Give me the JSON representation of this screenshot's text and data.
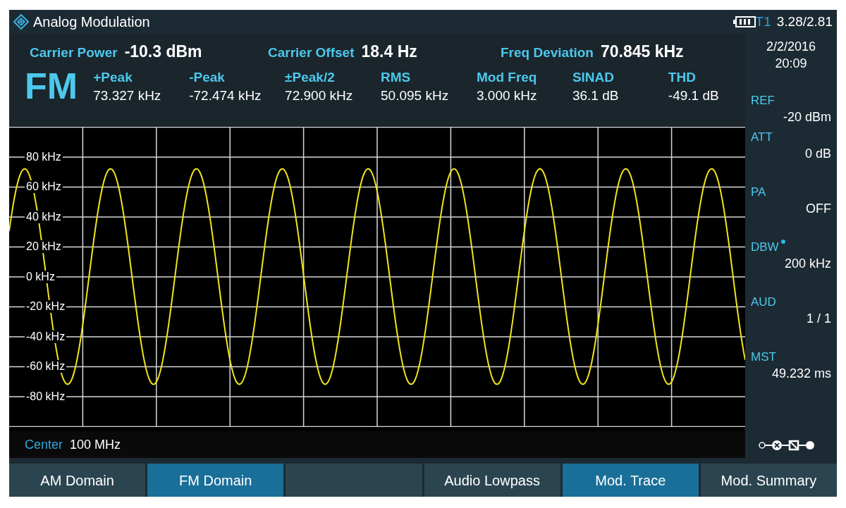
{
  "window": {
    "title": "Analog Modulation",
    "trace": "T1",
    "reading": "3.28/2.81",
    "date": "2/2/2016",
    "time": "20:09"
  },
  "summary": [
    {
      "label": "Carrier Power",
      "value": "-10.3 dBm"
    },
    {
      "label": "Carrier Offset",
      "value": "18.4 Hz"
    },
    {
      "label": "Freq Deviation",
      "value": "70.845 kHz"
    }
  ],
  "mode": "FM",
  "measurements": [
    {
      "label": "+Peak",
      "value": "73.327 kHz"
    },
    {
      "label": "-Peak",
      "value": "-72.474 kHz"
    },
    {
      "label": "±Peak/2",
      "value": "72.900 kHz"
    },
    {
      "label": "RMS",
      "value": "50.095 kHz"
    },
    {
      "label": "Mod Freq",
      "value": "3.000 kHz"
    },
    {
      "label": "SINAD",
      "value": "36.1 dB"
    },
    {
      "label": "THD",
      "value": "-49.1 dB"
    }
  ],
  "settings": [
    {
      "label": "REF",
      "value": "-20 dBm",
      "indicator": false
    },
    {
      "label": "ATT",
      "value": "0 dB",
      "indicator": false
    },
    {
      "label": "PA",
      "value": "OFF",
      "indicator": false
    },
    {
      "label": "DBW",
      "value": "200 kHz",
      "indicator": true
    },
    {
      "label": "AUD",
      "value": "1 / 1",
      "indicator": false
    },
    {
      "label": "MST",
      "value": "49.232 ms",
      "indicator": false
    }
  ],
  "y_axis_labels": [
    "80 kHz",
    "60 kHz",
    "40 kHz",
    "20 kHz",
    "0 kHz",
    "-20 kHz",
    "-40 kHz",
    "-60 kHz",
    "-80 kHz"
  ],
  "center": {
    "label": "Center",
    "value": "100 MHz"
  },
  "softkeys": [
    {
      "label": "AM Domain",
      "selected": false
    },
    {
      "label": "FM Domain",
      "selected": true
    },
    {
      "selected": false
    },
    {
      "label": "Audio Lowpass",
      "selected": false
    },
    {
      "label": "Mod. Trace",
      "selected": true
    },
    {
      "label": "Mod. Summary",
      "selected": false
    }
  ]
}
